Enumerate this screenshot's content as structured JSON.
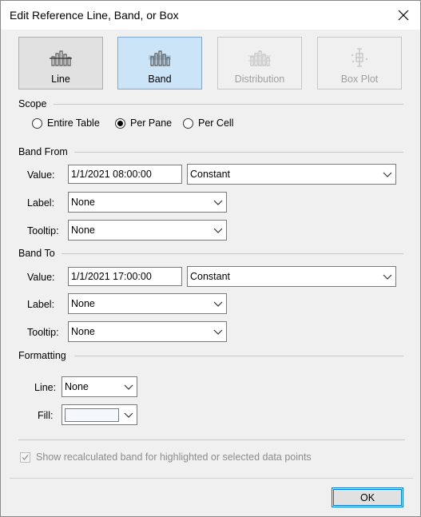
{
  "window": {
    "title": "Edit Reference Line, Band, or Box"
  },
  "types": [
    {
      "label": "Line",
      "state": "active"
    },
    {
      "label": "Band",
      "state": "selected"
    },
    {
      "label": "Distribution",
      "state": "disabled"
    },
    {
      "label": "Box Plot",
      "state": "disabled"
    }
  ],
  "scope": {
    "heading": "Scope",
    "options": [
      "Entire Table",
      "Per Pane",
      "Per Cell"
    ],
    "selected": "Per Pane"
  },
  "band_from": {
    "heading": "Band From",
    "value_label": "Value:",
    "value": "1/1/2021 08:00:00",
    "value_type": "Constant",
    "label_label": "Label:",
    "label_value": "None",
    "tooltip_label": "Tooltip:",
    "tooltip_value": "None"
  },
  "band_to": {
    "heading": "Band To",
    "value_label": "Value:",
    "value": "1/1/2021 17:00:00",
    "value_type": "Constant",
    "label_label": "Label:",
    "label_value": "None",
    "tooltip_label": "Tooltip:",
    "tooltip_value": "None"
  },
  "formatting": {
    "heading": "Formatting",
    "line_label": "Line:",
    "line_value": "None",
    "fill_label": "Fill:",
    "fill_color": "#f4f8fb"
  },
  "recalc_checkbox": {
    "label": "Show recalculated band for highlighted or selected data points",
    "checked": true,
    "enabled": false
  },
  "ok_button": {
    "label": "OK"
  },
  "colors": {
    "selected_fill": "#cce4f7",
    "selected_border": "#7fa8d4",
    "focus_blue": "#0078d7"
  }
}
